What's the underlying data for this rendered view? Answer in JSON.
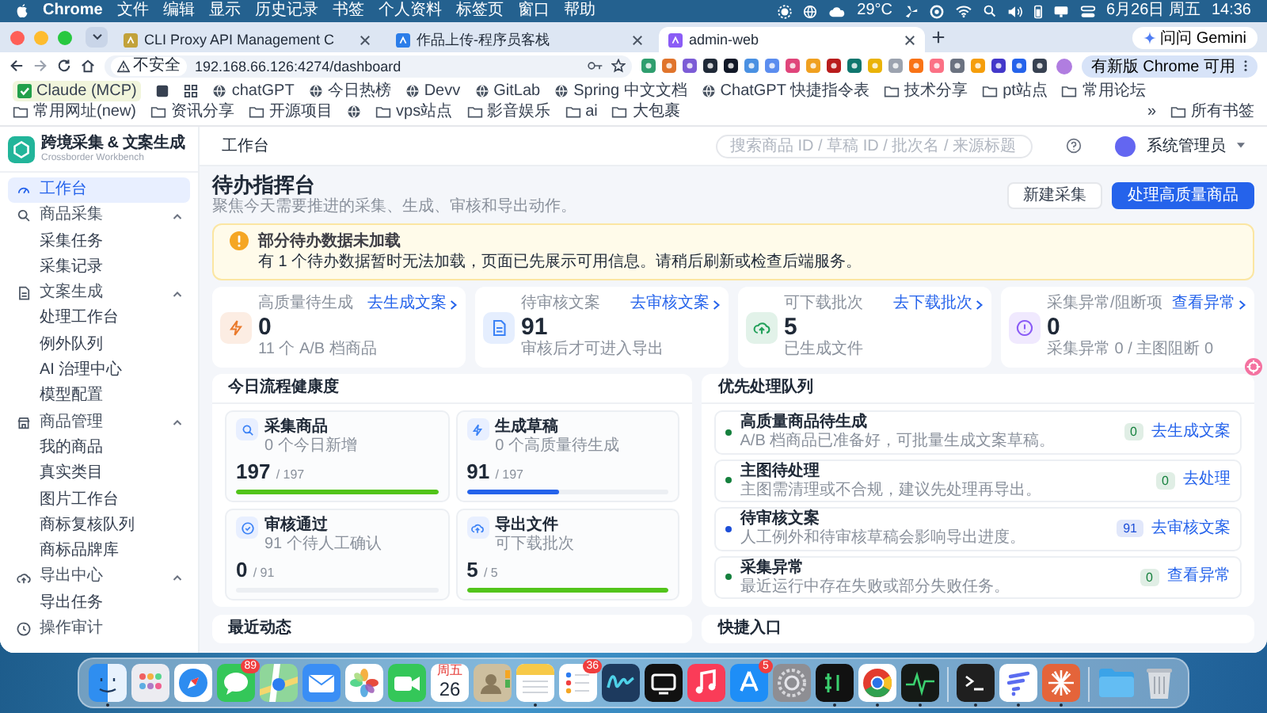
{
  "menu_bar": {
    "app": "Chrome",
    "menus": [
      "文件",
      "编辑",
      "显示",
      "历史记录",
      "书签",
      "个人资料",
      "标签页",
      "窗口",
      "帮助"
    ],
    "temperature": "29°C",
    "date": "6月26日 周五",
    "time": "14:36"
  },
  "browser": {
    "tabs": [
      {
        "title": "CLI Proxy API Management C",
        "selected": false
      },
      {
        "title": "作品上传-程序员客栈",
        "selected": false
      },
      {
        "title": "admin-web",
        "selected": true
      }
    ],
    "gemini_button": "问问 Gemini",
    "security": "不安全",
    "url": "192.168.66.126:4274/dashboard",
    "update_button": "有新版 Chrome 可用",
    "bookmarks": [
      {
        "kind": "extension",
        "label": "Claude (MCP)"
      },
      {
        "kind": "site",
        "label": "chatGPT"
      },
      {
        "kind": "site",
        "label": "今日热榜"
      },
      {
        "kind": "site",
        "label": "Devv"
      },
      {
        "kind": "site",
        "label": "GitLab"
      },
      {
        "kind": "site",
        "label": "Spring 中文文档"
      },
      {
        "kind": "site",
        "label": "ChatGPT 快捷指令表"
      },
      {
        "kind": "folder",
        "label": "技术分享"
      },
      {
        "kind": "folder",
        "label": "pt站点"
      },
      {
        "kind": "folder",
        "label": "常用论坛"
      },
      {
        "kind": "folder",
        "label": "常用网址(new)"
      },
      {
        "kind": "folder",
        "label": "资讯分享"
      },
      {
        "kind": "folder",
        "label": "开源项目"
      },
      {
        "kind": "site"
      },
      {
        "kind": "folder",
        "label": "vps站点"
      },
      {
        "kind": "folder",
        "label": "影音娱乐"
      },
      {
        "kind": "folder",
        "label": "ai"
      },
      {
        "kind": "folder",
        "label": "大包裹"
      }
    ],
    "more": "»",
    "all_bookmarks": "所有书签"
  },
  "sidebar": {
    "title": "跨境采集 & 文案生成",
    "subtitle": "Crossborder Workbench",
    "items": [
      {
        "kind": "link",
        "label": "工作台",
        "selected": true
      },
      {
        "kind": "group",
        "label": "商品采集",
        "expanded": true,
        "children": [
          {
            "label": "采集任务",
            "selected": false
          },
          {
            "label": "采集记录",
            "selected": false
          }
        ]
      },
      {
        "kind": "group",
        "label": "文案生成",
        "expanded": true,
        "children": [
          {
            "label": "处理工作台",
            "selected": false
          },
          {
            "label": "例外队列",
            "selected": false
          },
          {
            "label": "AI 治理中心",
            "selected": false
          },
          {
            "label": "模型配置",
            "selected": false
          }
        ]
      },
      {
        "kind": "group",
        "label": "商品管理",
        "expanded": true,
        "children": [
          {
            "label": "我的商品",
            "selected": false
          },
          {
            "label": "真实类目",
            "selected": false
          },
          {
            "label": "图片工作台",
            "selected": false
          },
          {
            "label": "商标复核队列",
            "selected": false
          },
          {
            "label": "商标品牌库",
            "selected": false
          }
        ]
      },
      {
        "kind": "group",
        "label": "导出中心",
        "expanded": true,
        "children": [
          {
            "label": "导出任务",
            "selected": false
          }
        ]
      },
      {
        "kind": "link",
        "label": "操作审计",
        "selected": false
      }
    ]
  },
  "header": {
    "breadcrumb": "工作台",
    "search_placeholder": "搜索商品 ID / 草稿 ID / 批次名 / 来源标题",
    "user": "系统管理员"
  },
  "page": {
    "title": "待办指挥台",
    "subtitle": "聚焦今天需要推进的采集、生成、审核和导出动作。",
    "buttons": [
      {
        "label": "新建采集",
        "kind": "secondary"
      },
      {
        "label": "处理高质量商品",
        "kind": "primary"
      }
    ]
  },
  "alert": {
    "title": "部分待办数据未加载",
    "message": "有 1 个待办数据暂时无法加载，页面已先展示可用信息。请稍后刷新或检查后端服务。"
  },
  "stats": [
    {
      "label": "高质量待生成",
      "value": "0",
      "note": "11 个 A/B 档商品",
      "link": "去生成文案",
      "color": "#ea7a2c"
    },
    {
      "label": "待审核文案",
      "value": "91",
      "note": "审核后才可进入导出",
      "link": "去审核文案",
      "color": "#3b82f6"
    },
    {
      "label": "可下载批次",
      "value": "5",
      "note": "已生成文件",
      "link": "去下载批次",
      "color": "#22a05a"
    },
    {
      "label": "采集异常/阻断项",
      "value": "0",
      "note": "采集异常 0 / 主图阻断 0",
      "link": "查看异常",
      "color": "#8b5cf6"
    }
  ],
  "health": {
    "title": "今日流程健康度",
    "items": [
      {
        "name": "采集商品",
        "note": "0 个今日新增",
        "value": "197",
        "total": "/ 197",
        "level": 1,
        "color": "#52c41a"
      },
      {
        "name": "生成草稿",
        "note": "0 个高质量待生成",
        "value": "91",
        "total": "/ 197",
        "level": 0.46,
        "color": "#2563eb"
      },
      {
        "name": "审核通过",
        "note": "91 个待人工确认",
        "value": "0",
        "total": "/ 91",
        "level": 0
      },
      {
        "name": "导出文件",
        "note": "可下载批次",
        "value": "5",
        "total": "/ 5",
        "level": 1,
        "color": "#52c41a"
      }
    ]
  },
  "queue": {
    "title": "优先处理队列",
    "items": [
      {
        "title": "高质量商品待生成",
        "note": "A/B 档商品已准备好，可批量生成文案草稿。",
        "count": "0",
        "link": "去生成文案",
        "color": "#15803d"
      },
      {
        "title": "主图待处理",
        "note": "主图需清理或不合规，建议先处理再导出。",
        "count": "0",
        "link": "去处理",
        "color": "#15803d"
      },
      {
        "title": "待审核文案",
        "note": "人工例外和待审核草稿会影响导出进度。",
        "count": "91",
        "link": "去审核文案",
        "color": "#1d4ed8"
      },
      {
        "title": "采集异常",
        "note": "最近运行中存在失败或部分失败任务。",
        "count": "0",
        "link": "查看异常",
        "color": "#15803d"
      }
    ]
  },
  "recent": {
    "title": "最近动态"
  },
  "shortcuts": {
    "title": "快捷入口"
  },
  "dock": {
    "apps": [
      {
        "kind": "finder",
        "running": true
      },
      {
        "kind": "launchpad",
        "running": false
      },
      {
        "kind": "safari",
        "running": false
      },
      {
        "kind": "messages",
        "running": false,
        "badge": "89"
      },
      {
        "kind": "maps",
        "running": false
      },
      {
        "kind": "mail",
        "running": false
      },
      {
        "kind": "photos",
        "running": false
      },
      {
        "kind": "facetime",
        "running": false
      },
      {
        "kind": "calendar",
        "running": false,
        "weekday": "周五",
        "day": "26"
      },
      {
        "kind": "contacts",
        "running": false
      },
      {
        "kind": "notes",
        "running": true
      },
      {
        "kind": "reminders",
        "running": false,
        "badge": "36"
      },
      {
        "kind": "freeform",
        "running": false
      },
      {
        "kind": "tv",
        "running": false
      },
      {
        "kind": "music",
        "running": false
      },
      {
        "kind": "appstore",
        "running": false,
        "badge": "5"
      },
      {
        "kind": "settings",
        "running": false
      },
      {
        "kind": "console",
        "running": true
      },
      {
        "kind": "chrome",
        "running": true
      },
      {
        "kind": "activity",
        "running": true
      },
      {
        "kind": "divider"
      },
      {
        "kind": "terminal",
        "running": true
      },
      {
        "kind": "stripes",
        "running": true
      },
      {
        "kind": "burst",
        "running": true
      },
      {
        "kind": "divider"
      },
      {
        "kind": "folder",
        "running": false
      },
      {
        "kind": "trash",
        "running": false
      }
    ]
  }
}
